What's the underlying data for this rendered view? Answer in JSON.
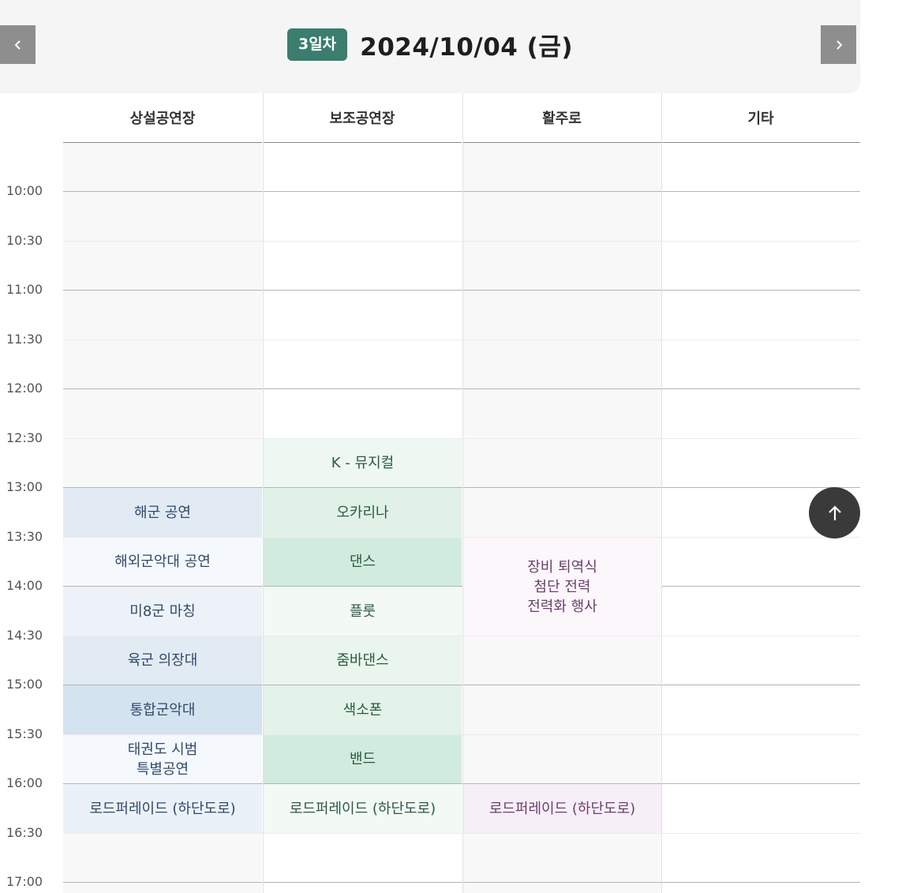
{
  "header": {
    "day_badge": "3일차",
    "date": "2024/10/04 (금)",
    "prev_icon": "chevron-left-icon",
    "next_icon": "chevron-right-icon"
  },
  "columns": [
    "상설공연장",
    "보조공연장",
    "활주로",
    "기타"
  ],
  "times": [
    "10:00",
    "10:30",
    "11:00",
    "11:30",
    "12:00",
    "12:30",
    "13:00",
    "13:30",
    "14:00",
    "14:30",
    "15:00",
    "15:30",
    "16:00",
    "16:30",
    "17:00"
  ],
  "events": [
    {
      "col": 1,
      "start": "12:30",
      "end": "13:00",
      "label": "K - 뮤지컬",
      "color": "#eef7f2"
    },
    {
      "col": 0,
      "start": "13:00",
      "end": "13:30",
      "label": "해군 공연",
      "color": "#e2eaf3"
    },
    {
      "col": 1,
      "start": "13:00",
      "end": "13:30",
      "label": "오카리나",
      "color": "#e1f1e8"
    },
    {
      "col": 0,
      "start": "13:30",
      "end": "14:00",
      "label": "해외군악대 공연",
      "color": "#f5f8fc"
    },
    {
      "col": 1,
      "start": "13:30",
      "end": "14:00",
      "label": "댄스",
      "color": "#d2ebdf"
    },
    {
      "col": 2,
      "start": "13:30",
      "end": "14:30",
      "label": "장비 퇴역식\n첨단 전력\n전력화 행사",
      "color": "#fbf7fb"
    },
    {
      "col": 0,
      "start": "14:00",
      "end": "14:30",
      "label": "미8군 마칭",
      "color": "#edf2f8"
    },
    {
      "col": 1,
      "start": "14:00",
      "end": "14:30",
      "label": "플룻",
      "color": "#f3f9f5"
    },
    {
      "col": 0,
      "start": "14:30",
      "end": "15:00",
      "label": "육군 의장대",
      "color": "#e2eaf3"
    },
    {
      "col": 1,
      "start": "14:30",
      "end": "15:00",
      "label": "줌바댄스",
      "color": "#eaf5ee"
    },
    {
      "col": 0,
      "start": "15:00",
      "end": "15:30",
      "label": "통합군악대",
      "color": "#d3e3f0"
    },
    {
      "col": 1,
      "start": "15:00",
      "end": "15:30",
      "label": "색소폰",
      "color": "#e4f3ea"
    },
    {
      "col": 0,
      "start": "15:30",
      "end": "16:00",
      "label": "태권도 시범\n특별공연",
      "color": "#f5f8fc"
    },
    {
      "col": 1,
      "start": "15:30",
      "end": "16:00",
      "label": "밴드",
      "color": "#d2ebdf"
    },
    {
      "col": 0,
      "start": "16:00",
      "end": "16:30",
      "label": "로드퍼레이드 (하단도로)",
      "color": "#ebf1f8"
    },
    {
      "col": 1,
      "start": "16:00",
      "end": "16:30",
      "label": "로드퍼레이드 (하단도로)",
      "color": "#f3f9f5"
    },
    {
      "col": 2,
      "start": "16:00",
      "end": "16:30",
      "label": "로드퍼레이드 (하단도로)",
      "color": "#f6eff7"
    }
  ],
  "scroll_top_icon": "arrow-up-icon",
  "colors": {
    "badge": "#3b7d6e",
    "column_shade": "#f8f8f8"
  }
}
